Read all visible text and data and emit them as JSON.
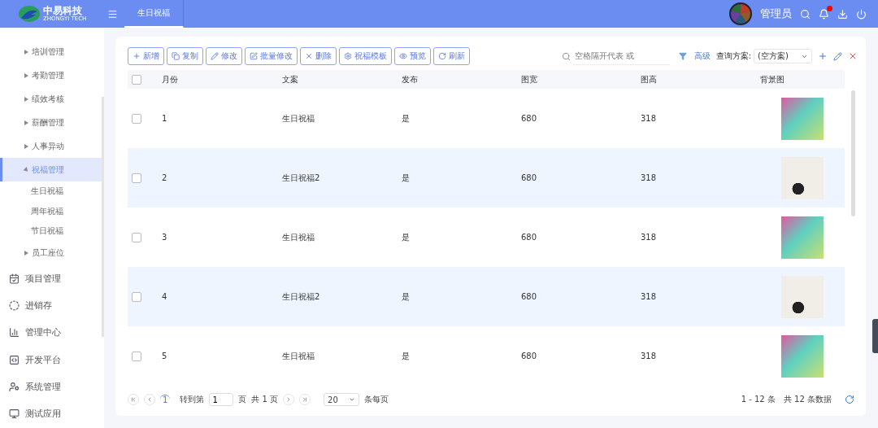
{
  "header": {
    "brand": "中易科技",
    "brand_sub": "ZHONGYI TECH",
    "tabs": [
      {
        "label": "生日祝福",
        "selected": true
      }
    ],
    "user": "管理员",
    "notification_dot": true
  },
  "sidebar": {
    "items": [
      {
        "kind": "submenu",
        "label": "培训管理",
        "expanded": false,
        "selected": false
      },
      {
        "kind": "submenu",
        "label": "考勤管理",
        "expanded": false,
        "selected": false
      },
      {
        "kind": "submenu",
        "label": "绩效考核",
        "expanded": false,
        "selected": false
      },
      {
        "kind": "submenu",
        "label": "薪酬管理",
        "expanded": false,
        "selected": false
      },
      {
        "kind": "submenu",
        "label": "人事异动",
        "expanded": false,
        "selected": false
      },
      {
        "kind": "submenu",
        "label": "祝福管理",
        "expanded": true,
        "selected": true,
        "children": [
          {
            "label": "生日祝福"
          },
          {
            "label": "周年祝福"
          },
          {
            "label": "节日祝福"
          }
        ]
      },
      {
        "kind": "submenu",
        "label": "员工座位",
        "expanded": false,
        "selected": false
      },
      {
        "kind": "module",
        "label": "项目管理"
      },
      {
        "kind": "module",
        "label": "进销存"
      },
      {
        "kind": "module",
        "label": "管理中心"
      },
      {
        "kind": "module",
        "label": "开发平台"
      },
      {
        "kind": "module",
        "label": "系统管理"
      },
      {
        "kind": "module",
        "label": "测试应用"
      }
    ]
  },
  "toolbar": {
    "buttons": [
      "新增",
      "复制",
      "修改",
      "批量修改",
      "删除",
      "祝福模板",
      "预览",
      "刷新"
    ],
    "search": {
      "placeholder": "空格隔开代表 或"
    },
    "advanced": "高级",
    "scheme_label": "查询方案:",
    "scheme_value": "(空方案)"
  },
  "table": {
    "all_checked": false,
    "columns": [
      "月份",
      "文案",
      "发布",
      "图宽",
      "图高",
      "背景图"
    ],
    "rows": [
      {
        "kind": "gradient",
        "cells": [
          "1",
          "生日祝福",
          "是",
          "680",
          "318"
        ],
        "checked": false
      },
      {
        "kind": "confetti",
        "cells": [
          "2",
          "生日祝福2",
          "是",
          "680",
          "318"
        ],
        "checked": false
      },
      {
        "kind": "gradient",
        "cells": [
          "3",
          "生日祝福",
          "是",
          "680",
          "318"
        ],
        "checked": false
      },
      {
        "kind": "confetti",
        "cells": [
          "4",
          "生日祝福2",
          "是",
          "680",
          "318"
        ],
        "checked": false
      },
      {
        "kind": "gradient",
        "cells": [
          "5",
          "生日祝福",
          "是",
          "680",
          "318"
        ],
        "checked": false
      }
    ]
  },
  "pagination": {
    "page": "1",
    "goto_label": "转到第",
    "goto_value": "1",
    "page_unit": "页",
    "total_pages": "共 1 页",
    "page_size": "20",
    "page_size_label": "条每页",
    "range": "1 - 12 条",
    "total": "共 12 条数据"
  }
}
